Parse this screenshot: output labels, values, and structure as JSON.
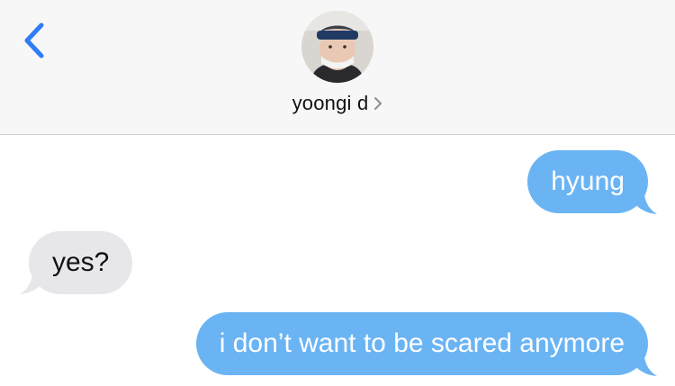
{
  "header": {
    "back_icon": "chevron-left-icon",
    "contact_name": "yoongi d",
    "contact_chevron_icon": "chevron-right-icon",
    "avatar_icon": "contact-avatar"
  },
  "colors": {
    "accent": "#2f7cf6",
    "outgoing_bubble": "#6bb4f4",
    "incoming_bubble": "#e6e6eb",
    "header_bg": "#f7f7f7"
  },
  "messages": [
    {
      "direction": "outgoing",
      "text": "hyung"
    },
    {
      "direction": "incoming",
      "text": "yes?"
    },
    {
      "direction": "outgoing",
      "text": "i don’t want to be scared anymore"
    }
  ]
}
